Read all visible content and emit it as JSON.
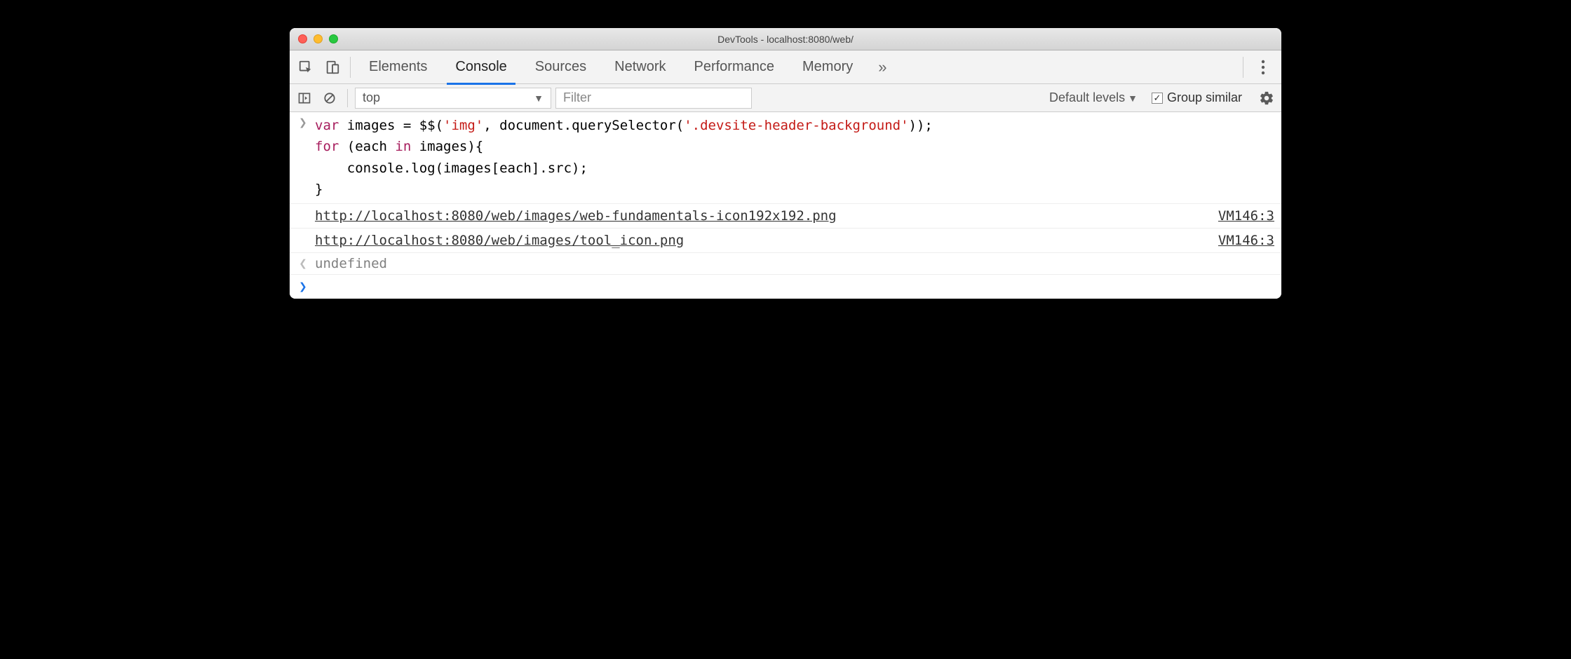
{
  "window": {
    "title": "DevTools - localhost:8080/web/"
  },
  "tabs": [
    {
      "label": "Elements",
      "active": false
    },
    {
      "label": "Console",
      "active": true
    },
    {
      "label": "Sources",
      "active": false
    },
    {
      "label": "Network",
      "active": false
    },
    {
      "label": "Performance",
      "active": false
    },
    {
      "label": "Memory",
      "active": false
    }
  ],
  "context": {
    "selected": "top"
  },
  "filter": {
    "placeholder": "Filter",
    "value": ""
  },
  "levels": {
    "label": "Default levels"
  },
  "group_similar": {
    "label": "Group similar",
    "checked": true
  },
  "code": {
    "line1_kw1": "var",
    "line1_id": " images ",
    "line1_eq": "= $$(",
    "line1_str1": "'img'",
    "line1_mid": ", document.querySelector(",
    "line1_str2": "'.devsite-header-background'",
    "line1_end": "));",
    "line2_kw": "for",
    "line2_rest": " (each ",
    "line2_kw2": "in",
    "line2_rest2": " images){",
    "line3": "    console.log(images[each].src);",
    "line4": "}"
  },
  "logs": [
    {
      "text": "http://localhost:8080/web/images/web-fundamentals-icon192x192.png",
      "source": "VM146:3"
    },
    {
      "text": "http://localhost:8080/web/images/tool_icon.png",
      "source": "VM146:3"
    }
  ],
  "return_value": "undefined"
}
